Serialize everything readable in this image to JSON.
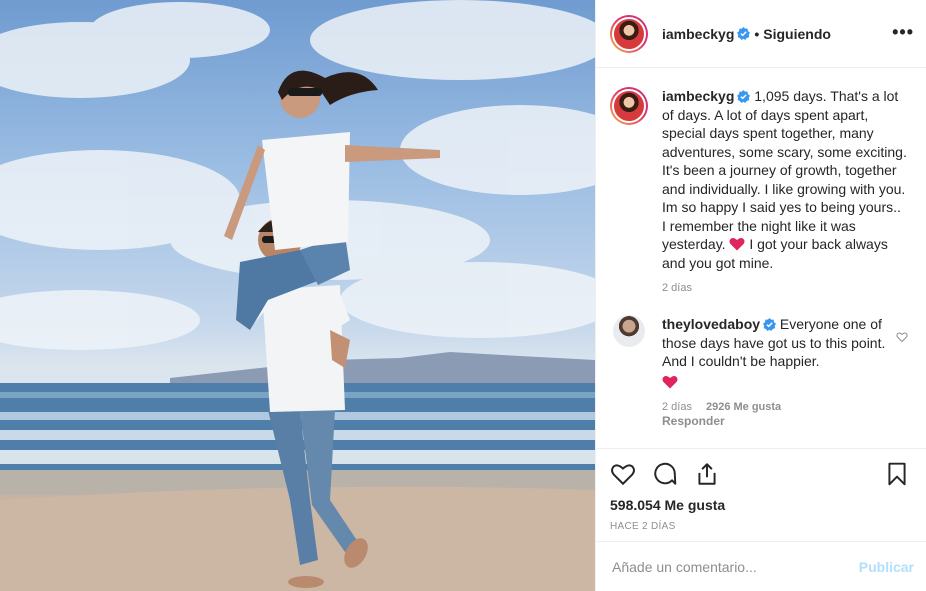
{
  "post": {
    "author": "iambeckyg",
    "follow_separator": "•",
    "follow_status": "Siguiendo",
    "more_label": "•••"
  },
  "caption": {
    "username": "iambeckyg",
    "text_before_heart": "1,095 days. That's a lot of days. A lot of days spent apart, special days spent together, many adventures, some scary, some exciting. It's been a journey of growth, together and individually. I like growing with you. Im so happy I said yes to being yours.. I remember the night like it was yesterday.",
    "text_after_heart": "I got your back always and you got mine.",
    "time": "2 días"
  },
  "comment": {
    "username": "theylovedaboy",
    "text": "Everyone one of those days have got us to this point. And I couldn't be happier.",
    "time": "2 días",
    "likes": "2926 Me gusta",
    "reply_label": "Responder"
  },
  "actions": {
    "likes_count": "598.054 Me gusta",
    "posted_ago": "Hace 2 días"
  },
  "composer": {
    "placeholder": "Añade un comentario...",
    "publish_label": "Publicar"
  },
  "colors": {
    "verified_blue": "#3897f0",
    "heart_red": "#e0245e",
    "publish_disabled": "#b2dffc",
    "secondary_text": "#8e8e8e"
  },
  "icons": [
    "heart-icon",
    "comment-icon",
    "share-icon",
    "bookmark-icon",
    "verified-icon",
    "more-options-icon"
  ]
}
